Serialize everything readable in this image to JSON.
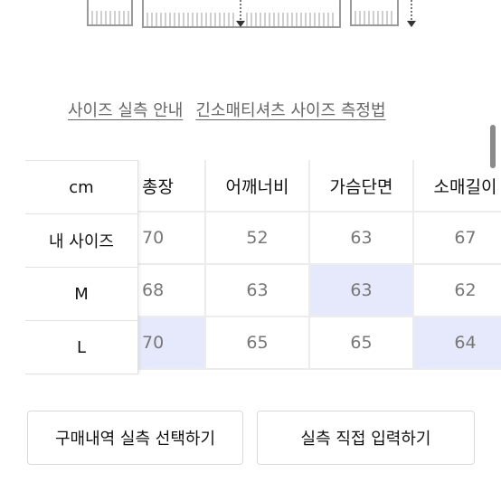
{
  "links": {
    "size_guide": "사이즈 실측 안내",
    "measure_method": "긴소매티셔츠 사이즈 측정법"
  },
  "table": {
    "corner": "cm",
    "columns": [
      "총장",
      "어깨너비",
      "가슴단면",
      "소매길이"
    ],
    "rows": [
      {
        "label": "내 사이즈",
        "values": [
          "70",
          "52",
          "63",
          "67"
        ],
        "highlight": [
          false,
          false,
          false,
          false
        ]
      },
      {
        "label": "M",
        "values": [
          "68",
          "63",
          "63",
          "62"
        ],
        "highlight": [
          false,
          false,
          true,
          false
        ]
      },
      {
        "label": "L",
        "values": [
          "70",
          "65",
          "65",
          "64"
        ],
        "highlight": [
          true,
          false,
          false,
          true
        ]
      }
    ]
  },
  "buttons": {
    "select_purchase": "구매내역 실측 선택하기",
    "direct_input": "실측 직접 입력하기"
  },
  "colors": {
    "highlight": "#e6e9fc",
    "grid_line": "#ececec"
  }
}
